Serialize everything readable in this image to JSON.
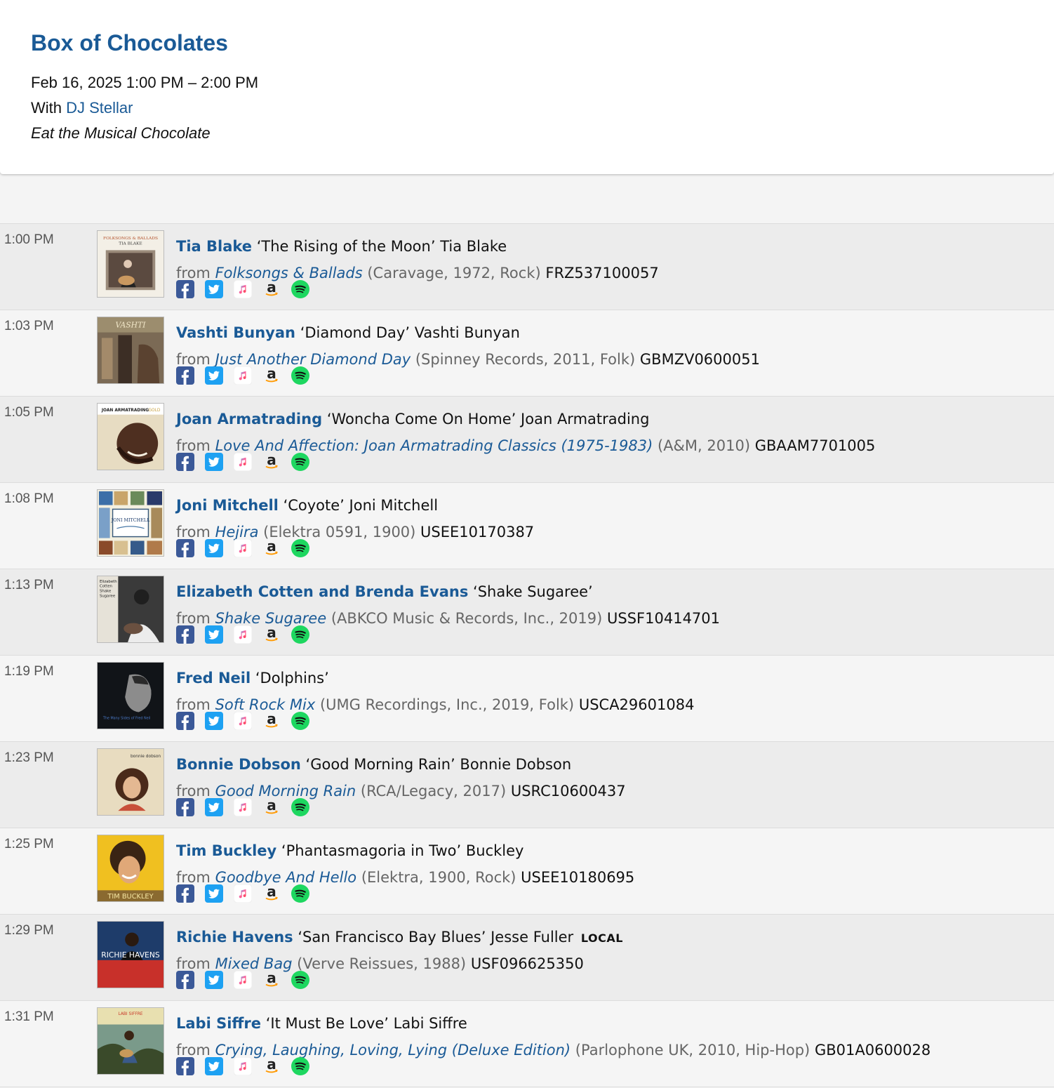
{
  "show": {
    "title": "Box of Chocolates",
    "datetime": "Feb 16, 2025 1:00 PM – 2:00 PM",
    "with_prefix": "With",
    "dj": "DJ Stellar",
    "tagline": "Eat the Musical Chocolate"
  },
  "labels": {
    "from": "from"
  },
  "icons": [
    "facebook-icon",
    "twitter-icon",
    "apple-music-icon",
    "amazon-icon",
    "spotify-icon"
  ],
  "colors": {
    "link": "#1a5a96",
    "facebook": "#3b5998",
    "twitter": "#1da1f2",
    "spotify": "#1ed760"
  },
  "tracks": [
    {
      "time": "1:00 PM",
      "artist": "Tia Blake",
      "song": "‘The Rising of the Moon’",
      "composer": "Tia Blake",
      "album": "Folksongs & Ballads",
      "details": "(Caravage, 1972, Rock)",
      "isrc": "FRZ537100057",
      "local": "",
      "art": "folksongs"
    },
    {
      "time": "1:03 PM",
      "artist": "Vashti Bunyan",
      "song": "‘Diamond Day’",
      "composer": "Vashti Bunyan",
      "album": "Just Another Diamond Day",
      "details": "(Spinney Records, 2011, Folk)",
      "isrc": "GBMZV0600051",
      "local": "",
      "art": "vashti"
    },
    {
      "time": "1:05 PM",
      "artist": "Joan Armatrading",
      "song": "‘Woncha Come On Home’",
      "composer": "Joan Armatrading",
      "album": "Love And Affection: Joan Armatrading Classics (1975-1983)",
      "details": "(A&M, 2010)",
      "isrc": "GBAAM7701005",
      "local": "",
      "art": "joan"
    },
    {
      "time": "1:08 PM",
      "artist": "Joni Mitchell",
      "song": "‘Coyote’",
      "composer": "Joni Mitchell",
      "album": "Hejira",
      "details": "(Elektra 0591, 1900)",
      "isrc": "USEE10170387",
      "local": "",
      "art": "joni"
    },
    {
      "time": "1:13 PM",
      "artist": "Elizabeth Cotten and Brenda Evans",
      "song": "‘Shake Sugaree’",
      "composer": "",
      "album": "Shake Sugaree",
      "details": "(ABKCO Music & Records, Inc., 2019)",
      "isrc": "USSF10414701",
      "local": "",
      "art": "cotten"
    },
    {
      "time": "1:19 PM",
      "artist": "Fred Neil",
      "song": "‘Dolphins’",
      "composer": "",
      "album": "Soft Rock Mix",
      "details": "(UMG Recordings, Inc., 2019, Folk)",
      "isrc": "USCA29601084",
      "local": "",
      "art": "fred"
    },
    {
      "time": "1:23 PM",
      "artist": "Bonnie Dobson",
      "song": "‘Good Morning Rain’",
      "composer": "Bonnie Dobson",
      "album": "Good Morning Rain",
      "details": "(RCA/Legacy, 2017)",
      "isrc": "USRC10600437",
      "local": "",
      "art": "bonnie"
    },
    {
      "time": "1:25 PM",
      "artist": "Tim Buckley",
      "song": "‘Phantasmagoria in Two’",
      "composer": "Buckley",
      "album": "Goodbye And Hello",
      "details": "(Elektra, 1900, Rock)",
      "isrc": "USEE10180695",
      "local": "",
      "art": "tim"
    },
    {
      "time": "1:29 PM",
      "artist": "Richie Havens",
      "song": "‘San Francisco Bay Blues’",
      "composer": "Jesse Fuller",
      "album": "Mixed Bag",
      "details": "(Verve Reissues, 1988)",
      "isrc": "USF096625350",
      "local": "LOCAL",
      "art": "richie"
    },
    {
      "time": "1:31 PM",
      "artist": "Labi Siffre",
      "song": "‘It Must Be Love’",
      "composer": "Labi Siffre",
      "album": "Crying, Laughing, Loving, Lying (Deluxe Edition)",
      "details": "(Parlophone UK, 2010, Hip-Hop)",
      "isrc": "GB01A0600028",
      "local": "",
      "art": "labi"
    }
  ],
  "art_text": {
    "folksongs": [
      "FOLKSONGS & BALLADS",
      "TIA BLAKE"
    ],
    "vashti": [
      "VASHTI"
    ],
    "joan": [
      "JOAN ARMATRADING",
      "GOLD"
    ],
    "joni": [
      "JONI MITCHELL"
    ],
    "cotten": [
      "Elizabeth",
      "Cotten",
      "Shake",
      "Sugaree"
    ],
    "fred": [
      "The Many Sides of Fred Neil"
    ],
    "bonnie": [
      "bonnie dobson"
    ],
    "tim": [
      "TIM BUCKLEY"
    ],
    "richie": [
      "RICHIE HAVENS"
    ],
    "labi": [
      "LABI SIFFRE"
    ]
  }
}
